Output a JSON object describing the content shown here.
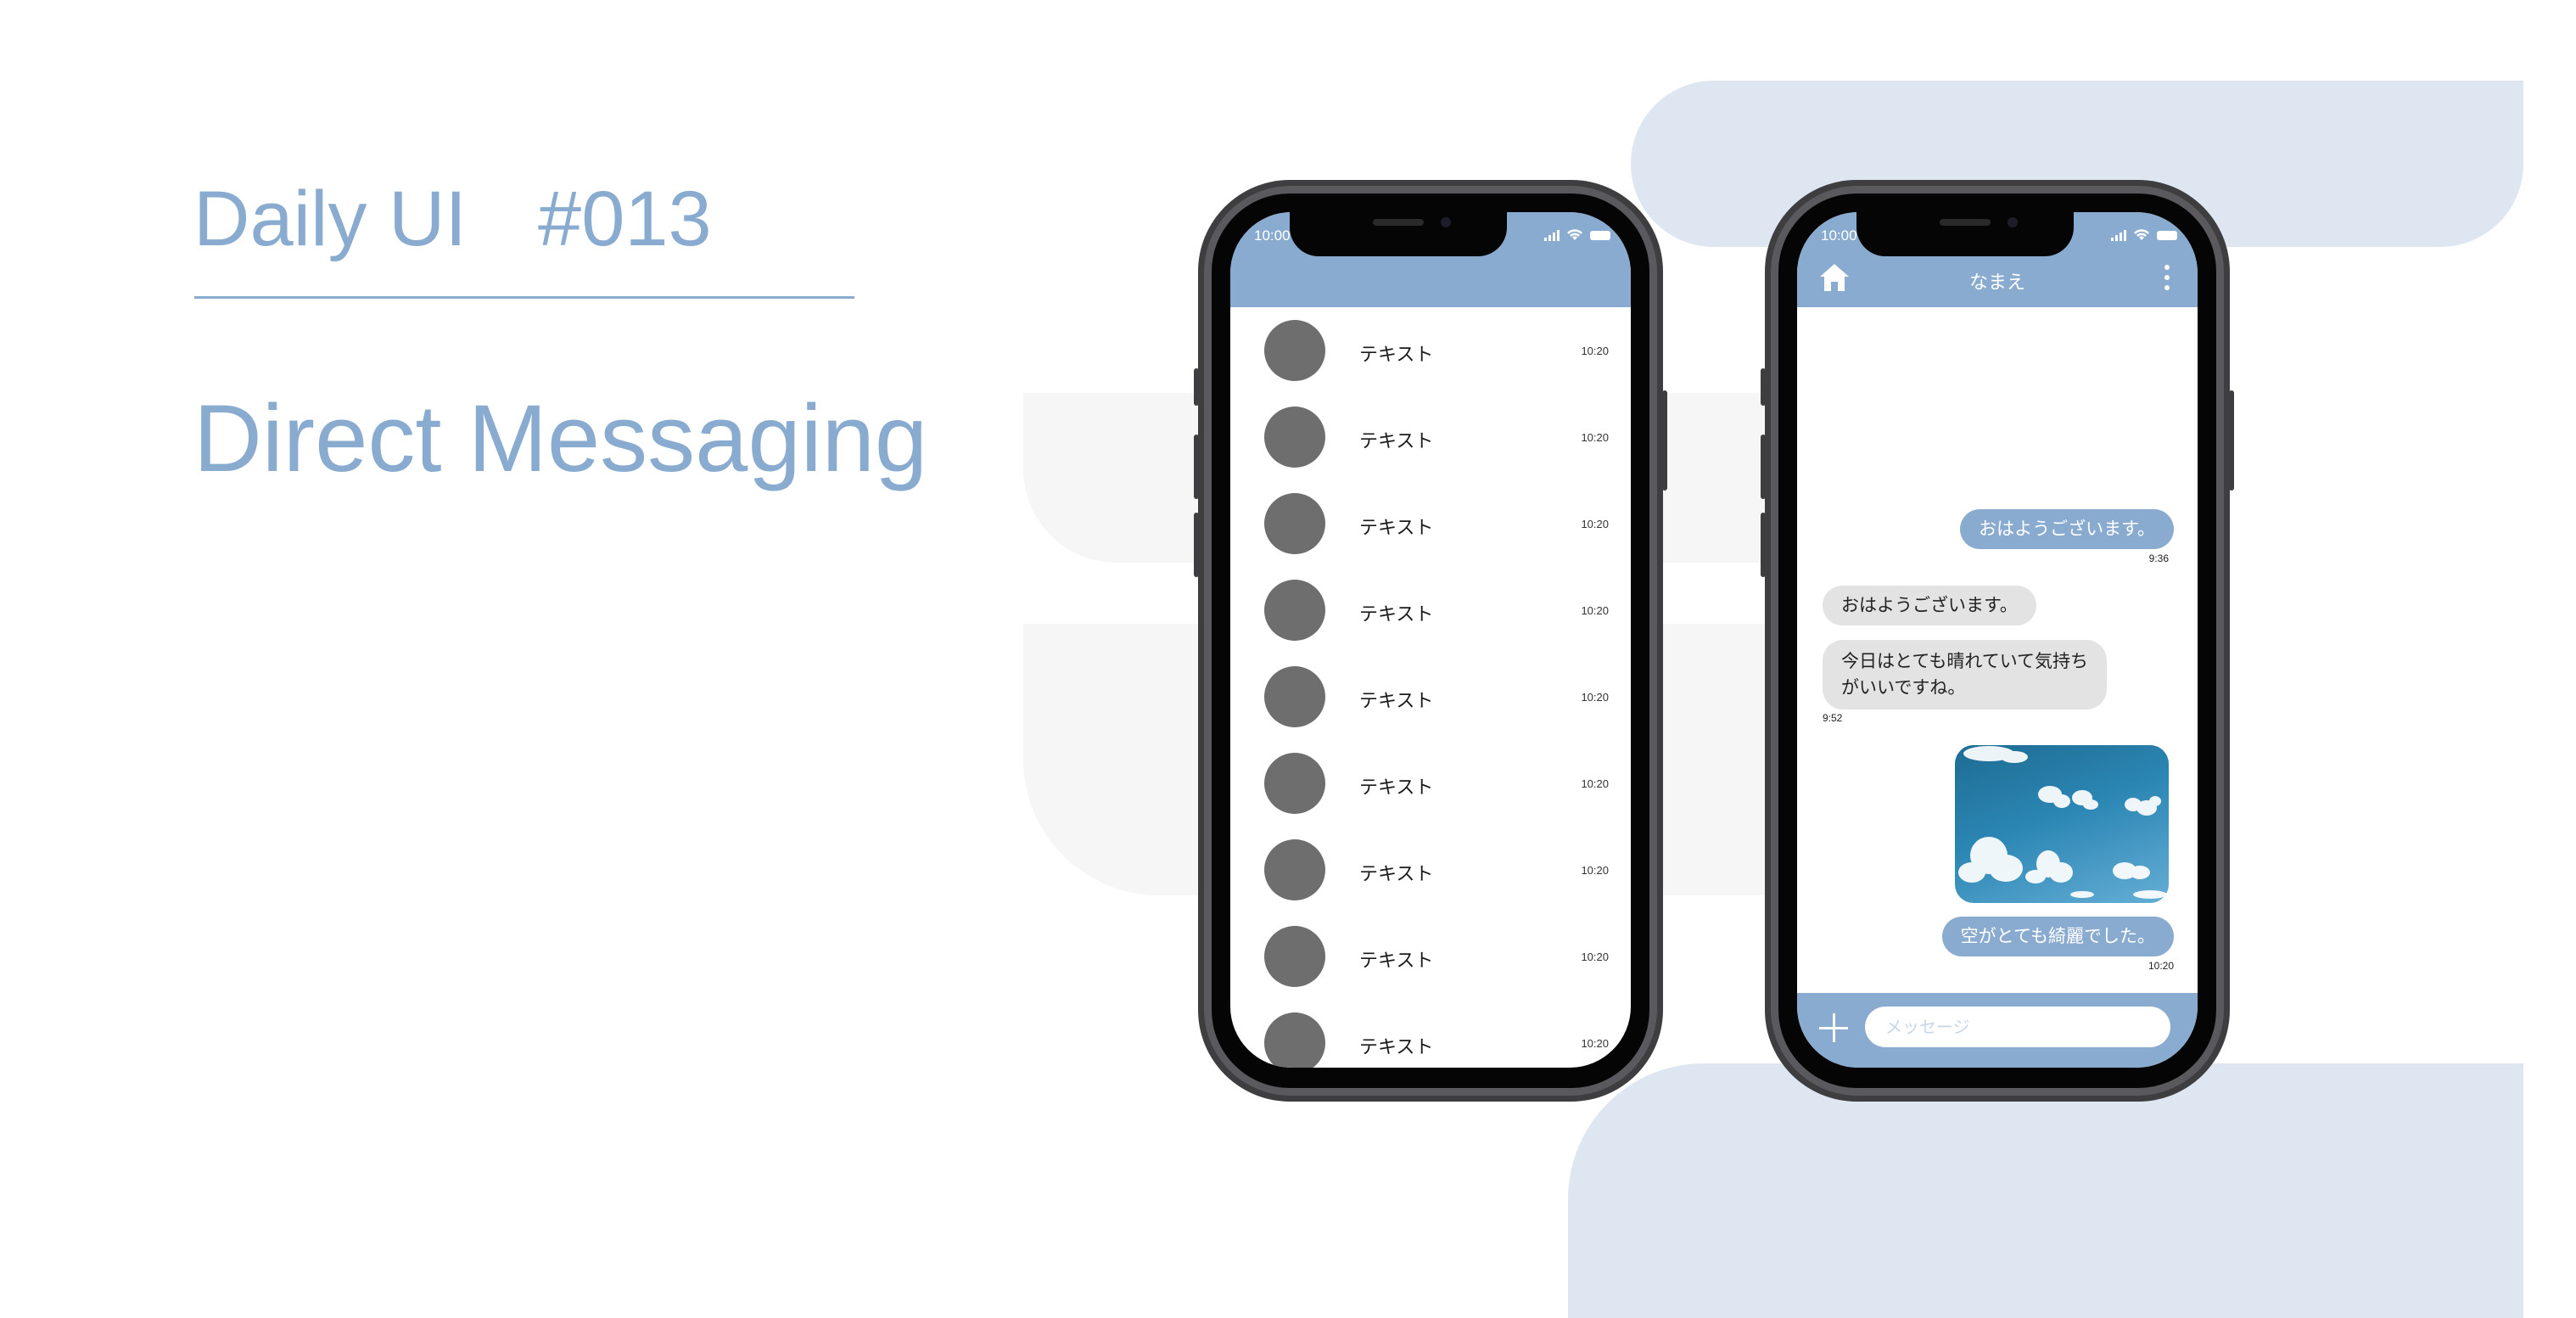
{
  "headline": {
    "daily": "Daily UI",
    "number": "#013",
    "subject": "Direct Messaging"
  },
  "colors": {
    "accent": "#8aabd0",
    "list_bg": "#edf4fd",
    "avatar": "#6e6e6e",
    "bubble_in": "#e3e3e3"
  },
  "left_phone": {
    "status_time": "10:00",
    "items": [
      {
        "name": "テキスト",
        "time": "10:20"
      },
      {
        "name": "テキスト",
        "time": "10:20"
      },
      {
        "name": "テキスト",
        "time": "10:20"
      },
      {
        "name": "テキスト",
        "time": "10:20"
      },
      {
        "name": "テキスト",
        "time": "10:20"
      },
      {
        "name": "テキスト",
        "time": "10:20"
      },
      {
        "name": "テキスト",
        "time": "10:20"
      },
      {
        "name": "テキスト",
        "time": "10:20"
      },
      {
        "name": "テキスト",
        "time": "10:20"
      }
    ]
  },
  "right_phone": {
    "status_time": "10:00",
    "title": "なまえ",
    "icons": {
      "home": "home-icon",
      "menu": "more-vertical-icon",
      "add": "plus-icon"
    },
    "messages": {
      "out1": "おはようございます。",
      "out1_time": "9:36",
      "in1": "おはようございます。",
      "in2_line1": "今日はとても晴れていて気持ち",
      "in2_line2": "がいいですね。",
      "in_time": "9:52",
      "out2": "空がとても綺麗でした。",
      "out2_time": "10:20"
    },
    "input_placeholder": "メッセージ"
  }
}
